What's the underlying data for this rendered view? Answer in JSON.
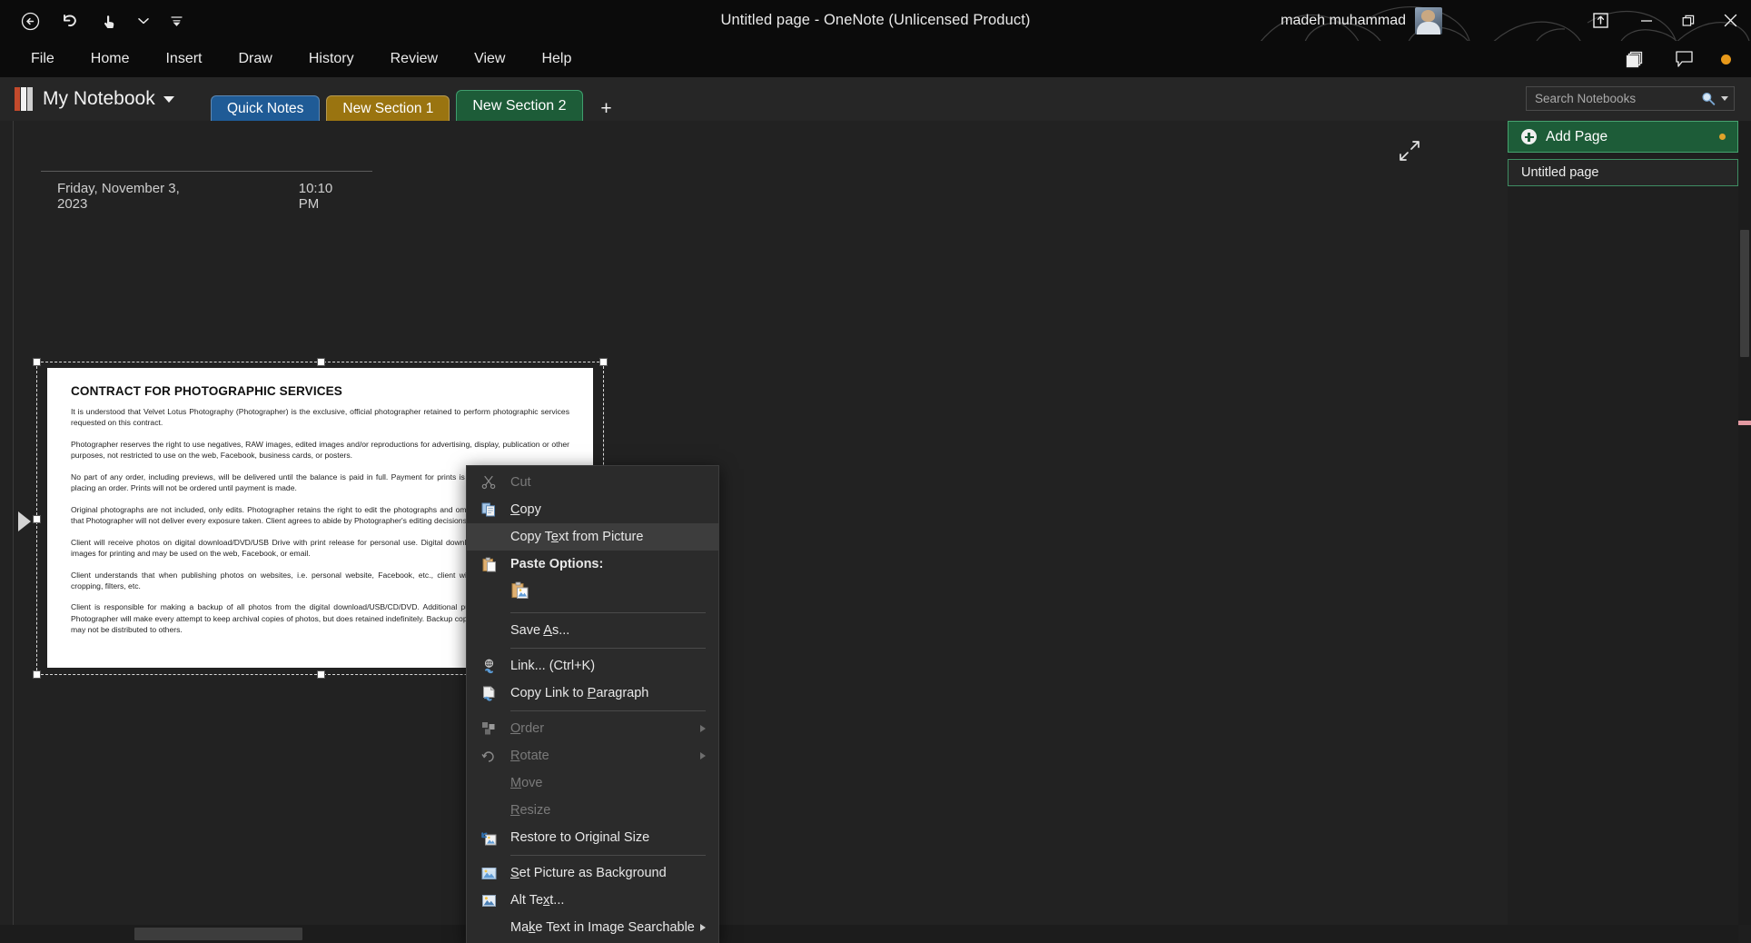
{
  "titlebar": {
    "title": "Untitled page  -  OneNote (Unlicensed Product)",
    "user_name": "madeh muhammad",
    "quick_access": [
      {
        "name": "back-button",
        "label": "Back"
      },
      {
        "name": "undo-button",
        "label": "Undo"
      },
      {
        "name": "touch-mode-button",
        "label": "Touch/Mouse Mode"
      },
      {
        "name": "qat-dropdown",
        "label": "Customize Quick Access Toolbar"
      }
    ],
    "window_controls": [
      {
        "name": "share-button",
        "label": "Share"
      },
      {
        "name": "minimize-button",
        "label": "Minimize"
      },
      {
        "name": "restore-button",
        "label": "Restore Down"
      },
      {
        "name": "close-button",
        "label": "Close"
      }
    ]
  },
  "ribbon": {
    "tabs": [
      {
        "label": "File"
      },
      {
        "label": "Home"
      },
      {
        "label": "Insert"
      },
      {
        "label": "Draw"
      },
      {
        "label": "History"
      },
      {
        "label": "Review"
      },
      {
        "label": "View"
      },
      {
        "label": "Help"
      }
    ],
    "right_icons": [
      {
        "name": "copy-stack-icon"
      },
      {
        "name": "comment-icon"
      },
      {
        "name": "status-dot-icon"
      }
    ]
  },
  "navbar": {
    "notebook_name": "My Notebook",
    "sections": [
      {
        "label": "Quick Notes",
        "color": "#1f5b96",
        "active": false
      },
      {
        "label": "New Section 1",
        "color": "#9a7410",
        "active": false
      },
      {
        "label": "New Section 2",
        "color": "#1d5c38",
        "active": true
      }
    ],
    "add_section_label": "+",
    "search": {
      "placeholder": "Search Notebooks",
      "value": ""
    }
  },
  "page": {
    "date": "Friday, November 3, 2023",
    "time": "10:10 PM",
    "document": {
      "title": "CONTRACT FOR PHOTOGRAPHIC SERVICES",
      "paragraphs": [
        "It is understood that Velvet Lotus Photography (Photographer) is the exclusive, official photographer retained to perform photographic services requested on this contract.",
        "Photographer reserves the right to use negatives, RAW images, edited images and/or reproductions for advertising, display, publication or other purposes, not restricted to use on the web, Facebook, business cards, or posters.",
        "No part of any order, including previews, will be delivered until the balance is paid in full. Payment for prints is required in full at the time of placing an order. Prints will not be ordered until payment is made.",
        "Original photographs are not included, only edits. Photographer retains the right to edit the photographs and omit any image. It is understood that Photographer will not deliver every exposure taken. Client agrees to abide by Photographer's editing decisions.",
        "Client will receive photos on digital download/DVD/USB Drive with print release for personal use. Digital download/DVD/USB Drive includes images for printing and may be used on the web, Facebook, or email.",
        "Client understands that when publishing photos on websites, i.e. personal website, Facebook, etc., client will not editing the watermark, cropping, filters, etc.",
        "Client is responsible for making a backup of all photos from the digital download/USB/CD/DVD. Additional purchased from Photographer. Photographer will make every attempt to keep archival copies of photos, but does retained indefinitely. Backup copies are for client use only and may not be distributed to others."
      ]
    }
  },
  "context_menu": {
    "items": [
      {
        "label": "Cut",
        "icon": "scissors-icon",
        "disabled": true,
        "highlight": false,
        "submenu": false
      },
      {
        "label": "Copy",
        "icon": "copy-icon",
        "disabled": false,
        "highlight": false,
        "submenu": false
      },
      {
        "label": "Copy Text from Picture",
        "icon": "",
        "disabled": false,
        "highlight": true,
        "submenu": false
      },
      {
        "label": "Paste Options:",
        "icon": "paste-icon",
        "disabled": false,
        "highlight": false,
        "submenu": false,
        "bold": true
      },
      {
        "label": "Save As...",
        "icon": "",
        "disabled": false,
        "highlight": false,
        "submenu": false
      },
      {
        "label": "Link...  (Ctrl+K)",
        "icon": "link-icon",
        "disabled": false,
        "highlight": false,
        "submenu": false
      },
      {
        "label": "Copy Link to Paragraph",
        "icon": "copy-link-icon",
        "disabled": false,
        "highlight": false,
        "submenu": false
      },
      {
        "label": "Order",
        "icon": "order-icon",
        "disabled": true,
        "highlight": false,
        "submenu": true
      },
      {
        "label": "Rotate",
        "icon": "rotate-icon",
        "disabled": true,
        "highlight": false,
        "submenu": true
      },
      {
        "label": "Move",
        "icon": "",
        "disabled": true,
        "highlight": false,
        "submenu": false
      },
      {
        "label": "Resize",
        "icon": "",
        "disabled": true,
        "highlight": false,
        "submenu": false
      },
      {
        "label": "Restore to Original Size",
        "icon": "restore-size-icon",
        "disabled": false,
        "highlight": false,
        "submenu": false
      },
      {
        "label": "Set Picture as Background",
        "icon": "set-background-icon",
        "disabled": false,
        "highlight": false,
        "submenu": false
      },
      {
        "label": "Alt Text...",
        "icon": "alt-text-icon",
        "disabled": false,
        "highlight": false,
        "submenu": false
      },
      {
        "label": "Make Text in Image Searchable",
        "icon": "",
        "disabled": false,
        "highlight": false,
        "submenu": true
      }
    ],
    "paste_option_icon": "paste-picture-icon"
  },
  "sidebar": {
    "add_page_label": "Add Page",
    "pages": [
      {
        "label": "Untitled page"
      }
    ]
  },
  "colors": {
    "accent_green": "#1d5c38",
    "section_blue": "#1f5b96",
    "section_gold": "#9a7410",
    "highlight": "#3d3d3d",
    "orange_dot": "#e8991a"
  }
}
